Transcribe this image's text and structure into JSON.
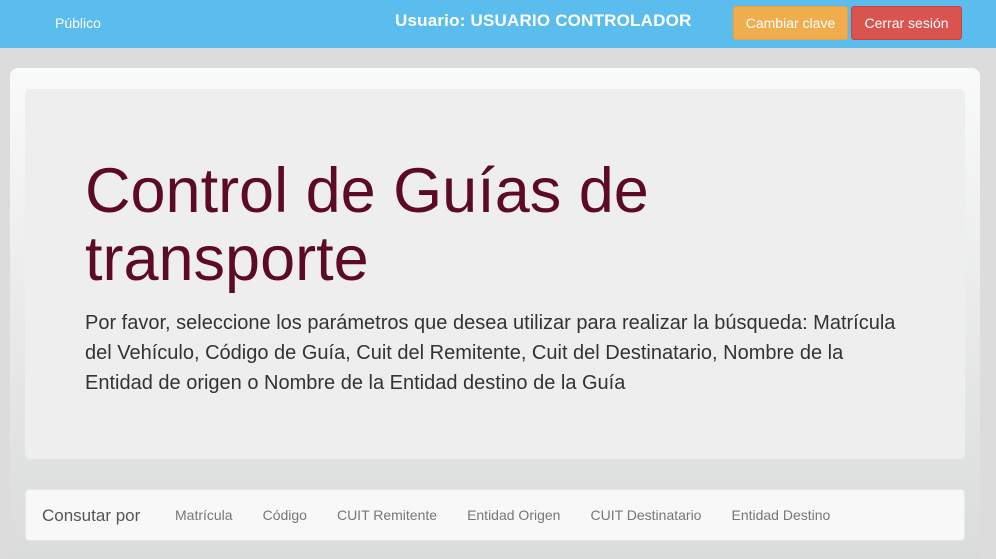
{
  "topbar": {
    "public_link": "Público",
    "user_label": "Usuario: USUARIO CONTROLADOR",
    "change_password_label": "Cambiar clave",
    "logout_label": "Cerrar sesión"
  },
  "jumbotron": {
    "title": "Control de Guías de transporte",
    "text": "Por favor, seleccione los parámetros que desea utilizar para realizar la búsqueda: Matrícula del Vehículo, Código de Guía, Cuit del Remitente, Cuit del Destinatario, Nombre de la Entidad de origen o Nombre de la Entidad destino de la Guía"
  },
  "search_nav": {
    "brand": "Consutar por",
    "items": [
      {
        "label": "Matrícula"
      },
      {
        "label": "Código"
      },
      {
        "label": "CUIT Remitente"
      },
      {
        "label": "Entidad Origen"
      },
      {
        "label": "CUIT Destinatario"
      },
      {
        "label": "Entidad Destino"
      }
    ]
  },
  "colors": {
    "topbar": "#5bbdee",
    "title": "#5d0b24",
    "warning_button": "#f0ad4e",
    "danger_button": "#d9534f"
  }
}
